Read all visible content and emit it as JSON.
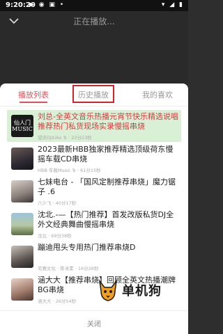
{
  "status_bar": {
    "time": "9:20:20",
    "indicators": "▶ ◉ ▣ •",
    "right_icons": "▾ ◢ ▮"
  },
  "player": {
    "now_playing": "正在播放..."
  },
  "tabs": [
    {
      "label": "播放列表",
      "active": true
    },
    {
      "label": "历史播放",
      "active": false
    },
    {
      "label": "我的喜欢",
      "active": false
    }
  ],
  "playlist": [
    {
      "title": "刘总-全英文音乐热播元宵节快乐精选说唱推荐热门私货现场实录慢摇串烧",
      "subtitle": "望庆DJXiAo ⇅ · 22分23秒",
      "thumb": "thumb-dark",
      "thumb_text": "仙人门\nMUSIC",
      "active": true
    },
    {
      "title": "2023最新HBB独家推荐精选顶级荷东慢摇车载CD串烧",
      "subtitle": "HBB·车载Music ⇅ · 61分15秒",
      "thumb": "thumb-face1",
      "thumb_text": "",
      "active": false
    },
    {
      "title": "七妹电台 - 「国风定制推荐串烧」魔力锯子 .6",
      "subtitle": "六少飞 · 40分17秒",
      "thumb": "thumb-face2",
      "thumb_text": "",
      "active": false
    },
    {
      "title": "沈北.-—【热门推荐】首发改版私货DJ全外文经典舞曲慢摇串烧",
      "subtitle": "沈北 · 69分38秒",
      "thumb": "thumb-scene",
      "thumb_text": "",
      "active": false
    },
    {
      "title": "蹦迪甩头专用热门推荐串烧D",
      "subtitle": "宅赛文化 · 陈寻素 · 16分28秒",
      "thumb": "thumb-shadow",
      "thumb_text": "",
      "active": false
    },
    {
      "title": "涵大大【推荐串烧】回顾全英文热播潮牌BG串烧",
      "subtitle": "涵大大 · 26分54秒",
      "thumb": "thumb-girl",
      "thumb_text": "",
      "active": false
    }
  ],
  "footer": {
    "close_label": "关闭"
  },
  "watermark": {
    "text": "单机狗"
  },
  "colors": {
    "accent": "#e0505a",
    "active_row": "#daf0d6",
    "highlight_box": "#d6202a"
  }
}
